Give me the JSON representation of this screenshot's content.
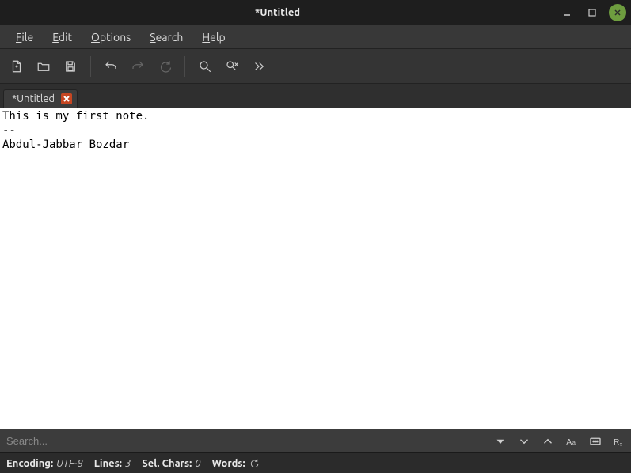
{
  "window": {
    "title": "*Untitled"
  },
  "menu": {
    "file": {
      "label": "File",
      "mnemonic": "F"
    },
    "edit": {
      "label": "Edit",
      "mnemonic": "E"
    },
    "options": {
      "label": "Options",
      "mnemonic": "O"
    },
    "search": {
      "label": "Search",
      "mnemonic": "S"
    },
    "help": {
      "label": "Help",
      "mnemonic": "H"
    }
  },
  "toolbar": {
    "new": "new-file-icon",
    "open": "open-folder-icon",
    "save": "save-icon",
    "undo": "undo-icon",
    "redo": "redo-icon",
    "redo2": "redo-alt-icon",
    "find": "search-icon",
    "replace": "find-replace-icon",
    "more": "chevron-double-right-icon"
  },
  "tab": {
    "label": "*Untitled"
  },
  "editor": {
    "content": "This is my first note.\n--\nAbdul-Jabbar Bozdar"
  },
  "search": {
    "placeholder": "Search..."
  },
  "status": {
    "encoding_label": "Encoding:",
    "encoding_value": "UTF-8",
    "lines_label": "Lines:",
    "lines_value": "3",
    "sel_label": "Sel. Chars:",
    "sel_value": "0",
    "words_label": "Words:"
  }
}
